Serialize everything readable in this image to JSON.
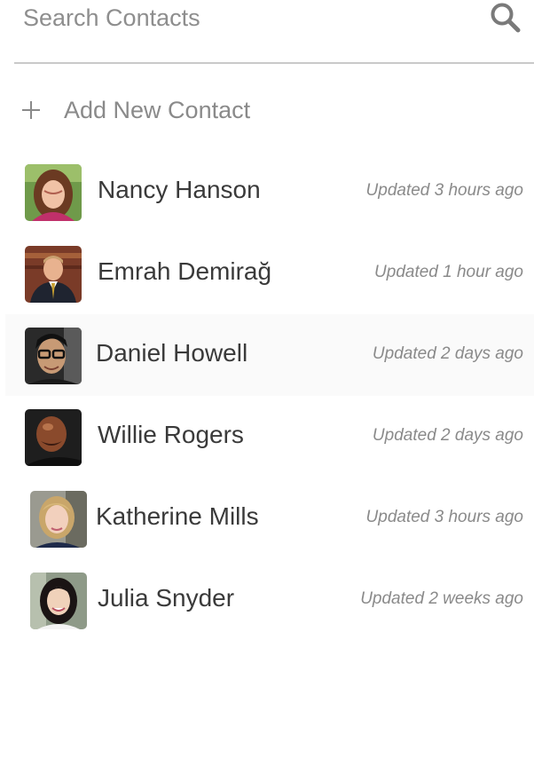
{
  "search": {
    "placeholder": "Search Contacts",
    "value": "",
    "icon": "search-icon"
  },
  "add_contact": {
    "label": "Add New Contact",
    "icon": "plus-icon"
  },
  "contacts": [
    {
      "name": "Nancy Hanson",
      "updated": "Updated 3 hours ago",
      "avatar": "avatar-woman-brown-hair"
    },
    {
      "name": "Emrah Demirağ",
      "updated": "Updated 1 hour ago",
      "avatar": "avatar-man-suit"
    },
    {
      "name": "Daniel Howell",
      "updated": "Updated 2 days ago",
      "avatar": "avatar-man-glasses"
    },
    {
      "name": "Willie Rogers",
      "updated": "Updated 2 days ago",
      "avatar": "avatar-man-bald"
    },
    {
      "name": "Katherine Mills",
      "updated": "Updated 3 hours ago",
      "avatar": "avatar-woman-blonde"
    },
    {
      "name": "Julia Snyder",
      "updated": "Updated 2 weeks ago",
      "avatar": "avatar-woman-dark-hair"
    }
  ],
  "colors": {
    "text": "#3a3a3a",
    "muted": "#8a8a8a",
    "divider": "#c9c9c9",
    "row_highlight": "#fafafa"
  }
}
